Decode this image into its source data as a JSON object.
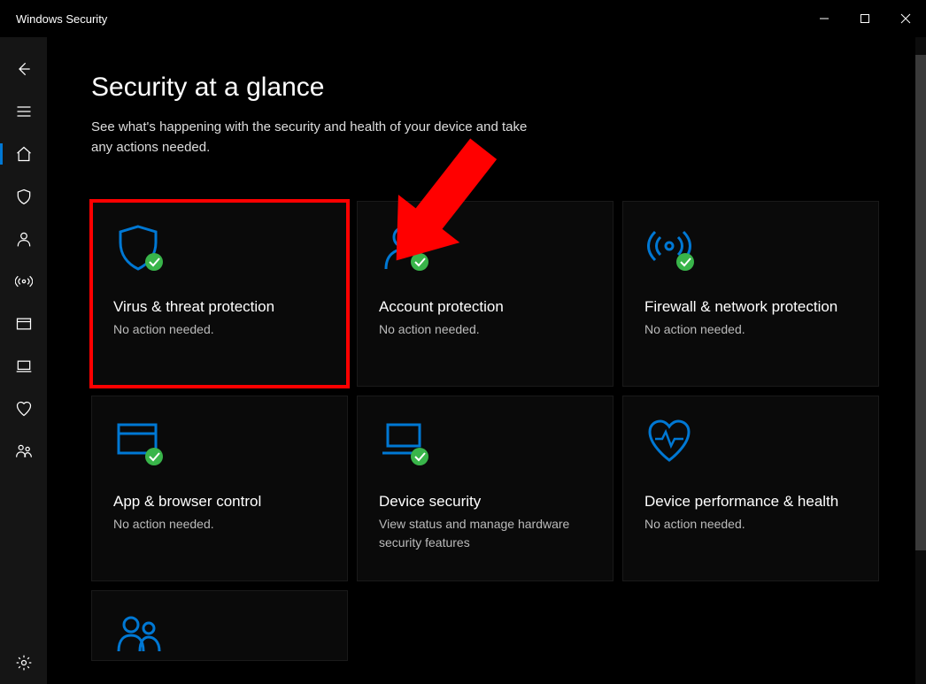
{
  "window": {
    "title": "Windows Security"
  },
  "page": {
    "title": "Security at a glance",
    "subtitle": "See what's happening with the security and health of your device and take any actions needed."
  },
  "tiles": {
    "virus": {
      "title": "Virus & threat protection",
      "status": "No action needed."
    },
    "account": {
      "title": "Account protection",
      "status": "No action needed."
    },
    "firewall": {
      "title": "Firewall & network protection",
      "status": "No action needed."
    },
    "appbrowser": {
      "title": "App & browser control",
      "status": "No action needed."
    },
    "device": {
      "title": "Device security",
      "status": "View status and manage hardware security features"
    },
    "performance": {
      "title": "Device performance & health",
      "status": "No action needed."
    }
  }
}
